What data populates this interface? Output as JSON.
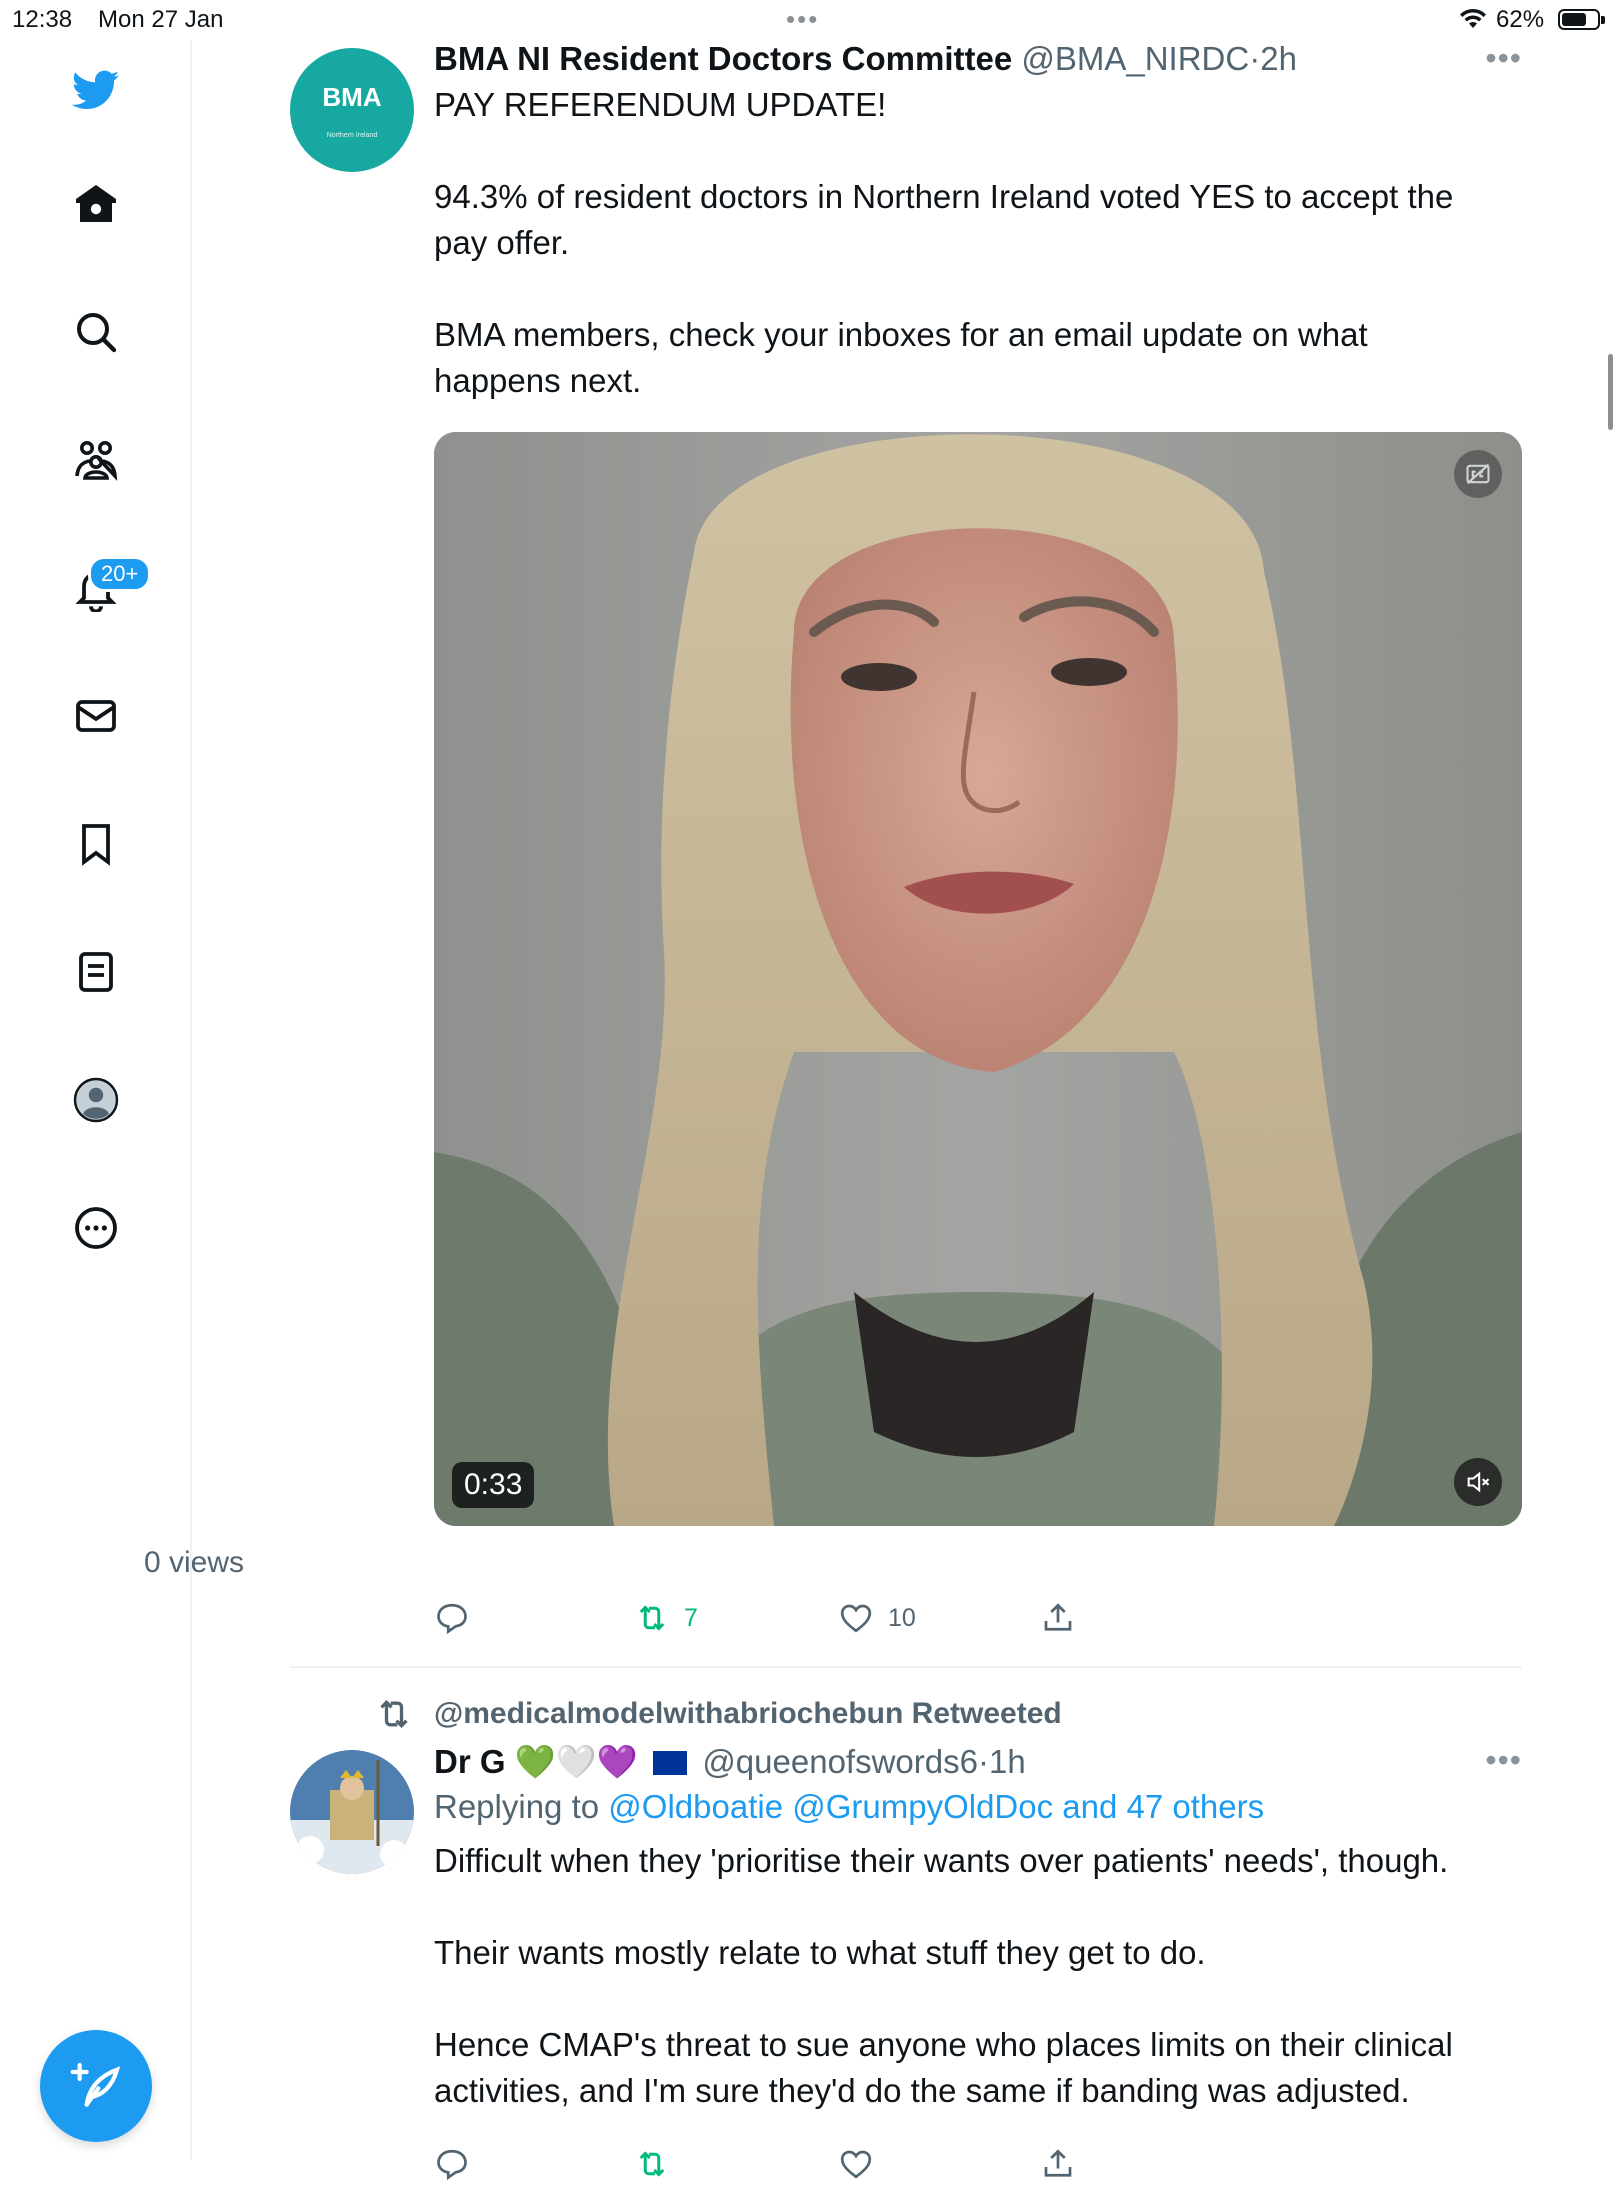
{
  "status_bar": {
    "time": "12:38",
    "date": "Mon 27 Jan",
    "battery": "62%"
  },
  "sidebar": {
    "notifications_badge": "20+",
    "items": [
      "home-icon",
      "search-icon",
      "communities-icon",
      "notifications-icon",
      "messages-icon",
      "bookmarks-icon",
      "lists-icon",
      "profile-icon",
      "more-icon"
    ]
  },
  "tweet1": {
    "name": "BMA NI Resident Doctors Committee",
    "handle": "@BMA_NIRDC",
    "separator": "·",
    "time": "2h",
    "avatar_text": "BMA",
    "avatar_subtext": "Northern Ireland",
    "lines": [
      "PAY REFERENDUM UPDATE!",
      "",
      "94.3% of resident doctors in Northern Ireland voted YES to accept the",
      "pay offer.",
      "",
      "BMA members, check your inboxes for an email update on what",
      "happens next."
    ],
    "video_duration": "0:33",
    "views": "0 views",
    "retweets": "7",
    "likes": "10",
    "accent_color": "#00ba7c"
  },
  "tweet2": {
    "retweeted_by": "@medicalmodelwithabriochebun Retweeted",
    "name": "Dr G",
    "emojis": "💚🤍💜",
    "handle": "@queenofswords6",
    "separator": "·",
    "time": "1h",
    "replying_label": "Replying to",
    "replying_users": "@Oldboatie @GrumpyOldDoc and 47 others",
    "lines": [
      "Difficult when they 'prioritise their wants over patients' needs', though.",
      "",
      "Their wants mostly relate to what stuff they get to do.",
      "",
      "Hence CMAP's threat to sue anyone who places limits on their clinical",
      "activities, and I'm sure they'd do the same if banding was adjusted."
    ]
  },
  "colors": {
    "accent": "#1d9bf0",
    "secondary_text": "#536471",
    "bma_teal": "#17a9a1"
  }
}
